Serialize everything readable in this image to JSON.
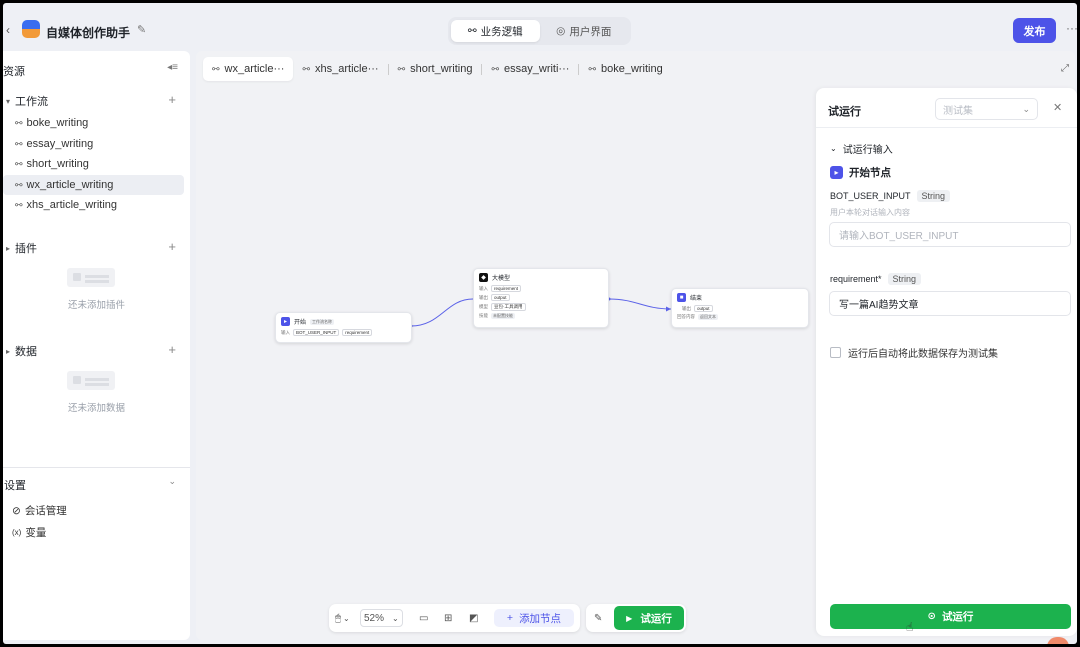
{
  "header": {
    "back_icon": "‹",
    "app_title": "自媒体创作助手",
    "tabs": [
      {
        "icon": "⚯",
        "label": "业务逻辑"
      },
      {
        "icon": "◎",
        "label": "用户界面"
      }
    ],
    "publish_label": "发布",
    "more_icon": "···",
    "accent": "#4d53e8"
  },
  "sidebar": {
    "title": "资源",
    "workflows": {
      "title": "工作流",
      "items": [
        "boke_writing",
        "essay_writing",
        "short_writing",
        "wx_article_writing",
        "xhs_article_writing"
      ],
      "active": "wx_article_writing"
    },
    "plugins": {
      "title": "插件",
      "empty_text": "还未添加插件"
    },
    "data": {
      "title": "数据",
      "empty_text": "还未添加数据"
    },
    "settings": {
      "title": "设置",
      "items": [
        {
          "icon": "⊘",
          "label": "会话管理"
        },
        {
          "icon": "(x)",
          "label": "变量"
        }
      ]
    }
  },
  "canvas": {
    "tabs": [
      "wx_article···",
      "xhs_article···",
      "short_writing",
      "essay_writi···",
      "boke_writing"
    ],
    "nodes": {
      "start": {
        "title": "开始",
        "tag": "工作流名称",
        "row_label": "输入",
        "chips": [
          "BOT_USER_INPUT",
          "requirement"
        ]
      },
      "llm": {
        "title": "大模型",
        "rows": [
          {
            "label": "输入",
            "chips": [
              "requirement"
            ]
          },
          {
            "label": "输出",
            "chips": [
              "output"
            ]
          },
          {
            "label": "模型",
            "chips": [
              "豆包·工具调用"
            ]
          },
          {
            "label": "技能",
            "chips": [
              "未配置技能"
            ]
          }
        ]
      },
      "end": {
        "title": "结束",
        "rows": [
          {
            "label": "输出",
            "chips": [
              "output"
            ]
          },
          {
            "label": "回答内容",
            "chips": [
              "返回文本"
            ]
          }
        ]
      }
    },
    "toolbar": {
      "zoom": "52%",
      "add_node_label": "添加节点",
      "run_label": "试运行"
    }
  },
  "panel": {
    "title": "试运行",
    "select_placeholder": "测试集",
    "section_label": "试运行输入",
    "node_label": "开始节点",
    "fields": [
      {
        "name": "BOT_USER_INPUT",
        "type": "String",
        "desc": "用户本轮对话输入内容",
        "placeholder": "请输入BOT_USER_INPUT",
        "value": ""
      },
      {
        "name": "requirement*",
        "type": "String",
        "desc": "",
        "placeholder": "",
        "value": "写一篇AI趋势文章"
      }
    ],
    "save_checkbox_label": "运行后自动将此数据保存为测试集",
    "run_button_label": "试运行",
    "run_color": "#1cb24e"
  }
}
